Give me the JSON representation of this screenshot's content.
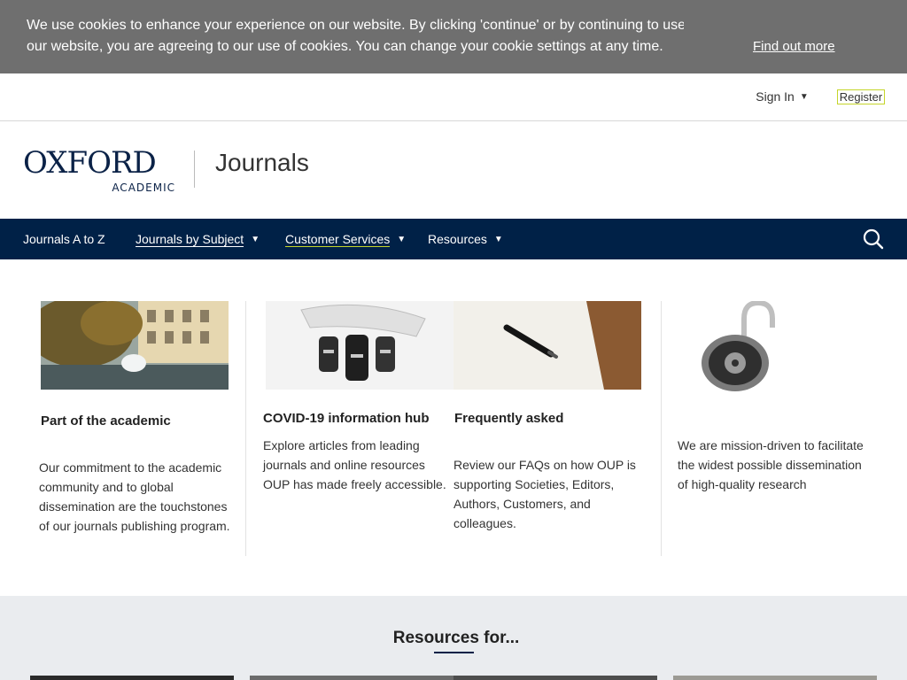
{
  "cookie": {
    "message_line1": "We use cookies to enhance your experience on our website. By clicking 'continue' or by continuing to use",
    "message_line2": "our website, you are agreeing to our use of cookies. You can change your cookie settings at any time.",
    "link": "Find out more"
  },
  "account": {
    "signin": "Sign In",
    "register": "Register"
  },
  "brand": {
    "logo_main": "OXFORD",
    "logo_sub": "ACADEMIC",
    "title": "Journals"
  },
  "nav": {
    "items": [
      "Journals A to Z",
      "Journals by Subject",
      "Customer Services",
      "Resources"
    ]
  },
  "cards": [
    {
      "heading": "Part of the academic",
      "body": "Our commitment to the academic community and to global dissemination are the touchstones of our journals publishing program."
    },
    {
      "heading": "COVID-19 information hub",
      "body": "Explore articles from leading journals and online resources OUP has made freely accessible."
    },
    {
      "heading": "Frequently asked",
      "body": "Review our FAQs on how OUP is supporting Societies, Editors, Authors, Customers, and colleagues."
    },
    {
      "heading": "",
      "body": "We are mission-driven to facilitate the widest possible dissemination of high-quality research"
    }
  ],
  "resources": {
    "heading": "Resources for..."
  },
  "colors": {
    "nav_bg": "#002147",
    "cookie_bg": "#6f6f6f",
    "accent": "#c5d52a"
  }
}
